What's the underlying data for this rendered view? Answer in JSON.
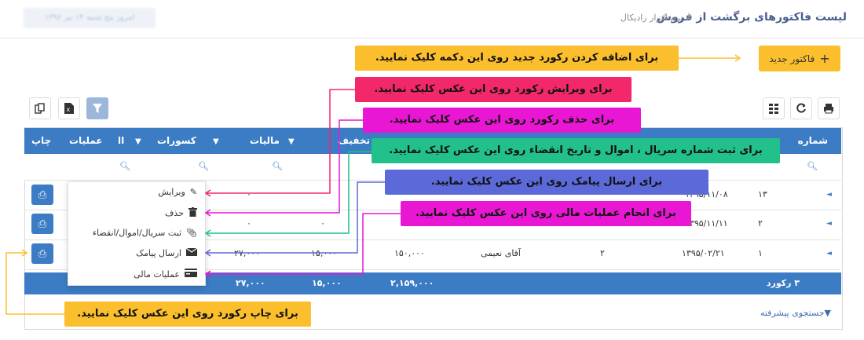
{
  "header": {
    "title": "لیست فاکتورهای برگشت از فروش",
    "breadcrumb": "# نرم افزار رادیکال",
    "blurred_date": "امروز پنج شنبه ۱۴ تیر ۱۳۹۶"
  },
  "toolbar": {
    "new_invoice_label": "فاکتور جدید"
  },
  "callouts": {
    "add": "برای اضافه کردن رکورد جدید روی این دکمه کلیک نمایید.",
    "edit": "برای ویرایش رکورد روی این عکس کلیک نمایید.",
    "delete": "برای حذف رکورد روی این عکس کلیک نمایید.",
    "serial": "برای ثبت شماره سریال ، اموال و تاریخ انقضاء روی این عکس کلیک نمایید.",
    "sms": "برای ارسال پیامک روی این عکس کلیک نمایید.",
    "finance": "برای انجام عملیات مالی روی این عکس کلیک نمایید.",
    "print": "برای چاپ رکورد روی این عکس کلیک نمایید."
  },
  "table": {
    "columns": {
      "number": "شماره",
      "discount": "تخفیف",
      "tax": "مالیات",
      "deductions": "کسورات",
      "ops_a": "اا",
      "ops": "عملیات",
      "print": "چاپ"
    },
    "rows": [
      {
        "number": "۱۳",
        "date": "۱۳۹۵/۱۱/۰۸",
        "tax": "۰",
        "discount": "۰"
      },
      {
        "number": "۲",
        "date": "۱۳۹۵/۱۱/۱۱",
        "tax": "۰",
        "discount": "۰"
      },
      {
        "number": "۱",
        "date": "۱۳۹۵/۰۲/۲۱",
        "qty": "۲",
        "customer": "آقای نعیمی",
        "amount": "۱۵۰,۰۰۰",
        "discount": "۱۵,۰۰۰",
        "tax": "۲۷,۰۰۰"
      }
    ],
    "footer": {
      "count": "۳ رکورد",
      "amount_total": "۲,۱۵۹,۰۰۰",
      "discount_total": "۱۵,۰۰۰",
      "tax_total": "۲۷,۰۰۰"
    }
  },
  "menu": {
    "edit": "ویرایش",
    "delete": "حذف",
    "serial": "ثبت سریال/اموال/انقضاء",
    "sms": "ارسال پیامک",
    "finance": "عملیات مالی"
  },
  "advanced_search": "جستجوی پیشرفته",
  "colors": {
    "header_blue": "#3b7cc4",
    "yellow": "#fbbf2e",
    "pink": "#f2286a",
    "magenta": "#e917d4",
    "green": "#22c08a",
    "purple": "#5b6ad8"
  }
}
